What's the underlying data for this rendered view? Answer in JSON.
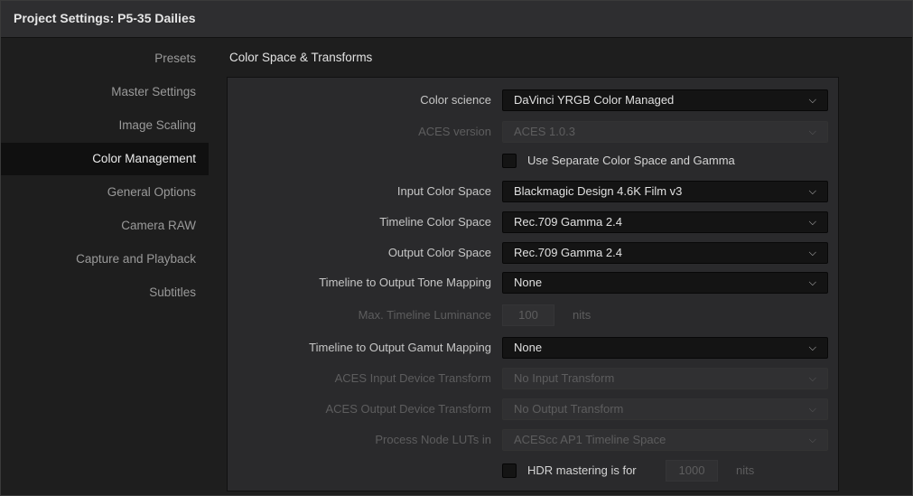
{
  "window": {
    "title": "Project Settings:  P5-35 Dailies"
  },
  "sidebar": {
    "items": [
      {
        "label": "Presets"
      },
      {
        "label": "Master Settings"
      },
      {
        "label": "Image Scaling"
      },
      {
        "label": "Color Management",
        "active": true
      },
      {
        "label": "General Options"
      },
      {
        "label": "Camera RAW"
      },
      {
        "label": "Capture and Playback"
      },
      {
        "label": "Subtitles"
      }
    ]
  },
  "section": {
    "title": "Color Space & Transforms"
  },
  "fields": {
    "color_science": {
      "label": "Color science",
      "value": "DaVinci YRGB Color Managed"
    },
    "aces_version": {
      "label": "ACES version",
      "value": "ACES 1.0.3",
      "disabled": true
    },
    "separate_color_gamma": {
      "label": "Use Separate Color Space and Gamma",
      "checked": false
    },
    "input_color_space": {
      "label": "Input Color Space",
      "value": "Blackmagic Design 4.6K Film v3"
    },
    "timeline_color_space": {
      "label": "Timeline Color Space",
      "value": "Rec.709 Gamma 2.4"
    },
    "output_color_space": {
      "label": "Output Color Space",
      "value": "Rec.709 Gamma 2.4"
    },
    "tone_mapping": {
      "label": "Timeline to Output Tone Mapping",
      "value": "None"
    },
    "max_luminance": {
      "label": "Max. Timeline Luminance",
      "value": "100",
      "unit": "nits",
      "disabled": true
    },
    "gamut_mapping": {
      "label": "Timeline to Output Gamut Mapping",
      "value": "None"
    },
    "aces_input_transform": {
      "label": "ACES Input Device Transform",
      "value": "No Input Transform",
      "disabled": true
    },
    "aces_output_transform": {
      "label": "ACES Output Device Transform",
      "value": "No Output Transform",
      "disabled": true
    },
    "process_node_luts": {
      "label": "Process Node LUTs in",
      "value": "ACEScc AP1 Timeline Space",
      "disabled": true
    },
    "hdr_mastering": {
      "label": "HDR mastering is for",
      "value": "1000",
      "unit": "nits",
      "checked": false
    }
  },
  "icons": {
    "dropdown_arrow": "chevron-down-icon",
    "chevron_glyph": "⌵"
  },
  "colors": {
    "panel_bg": "#2a2a2c",
    "field_bg": "#141414",
    "active_item_bg": "#101010",
    "disabled_text": "#5d5d5e"
  }
}
